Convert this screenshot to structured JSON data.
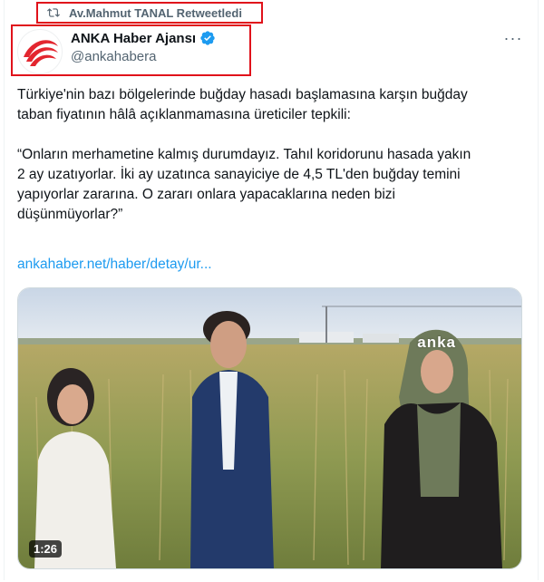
{
  "retweet": {
    "icon": "retweet-icon",
    "label": "Av.Mahmut TANAL Retweetledi"
  },
  "author": {
    "name": "ANKA Haber Ajansı",
    "handle": "@ankahabera",
    "verified_icon": "verified-badge-icon",
    "more_icon": "more-options-icon",
    "more_label": "···"
  },
  "tweet": {
    "text": "Türkiye'nin bazı bölgelerinde buğday hasadı başlamasına karşın buğday\ntaban fiyatının hâlâ açıklanmamasına üreticiler tepkili:\n\n“Onların merhametine kalmış durumdayız. Tahıl koridorunu hasada yakın\n2 ay uzatıyorlar. İki ay uzatınca sanayiciye de 4,5 TL'den buğday temini\nyapıyorlar zararına. O zararı onlara yapacaklarına neden bizi\ndüşünmüyorlar?”",
    "link": "ankahaber.net/haber/detay/ur..."
  },
  "media": {
    "watermark": "anka",
    "duration": "1:26"
  },
  "colors": {
    "accent_link": "#1d9bf0",
    "verified": "#1d9bf0",
    "highlight_border": "#e0121b",
    "secondary_text": "#536471"
  }
}
